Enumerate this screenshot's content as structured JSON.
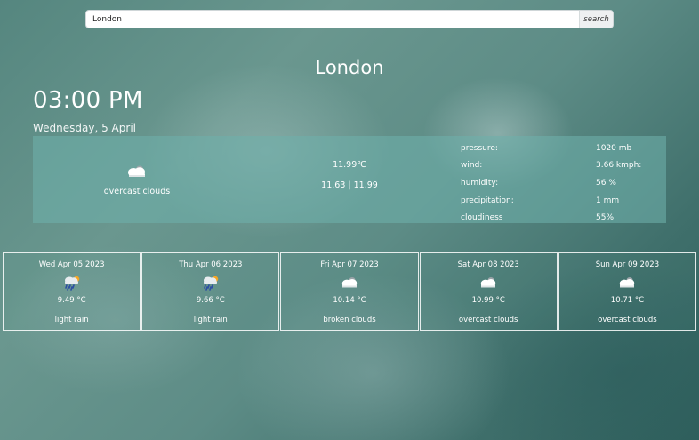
{
  "search": {
    "value": "London",
    "button_label": "search"
  },
  "city": "London",
  "time": "03:00 PM",
  "date": "Wednesday, 5 April",
  "current": {
    "icon": "cloud-icon",
    "description": "overcast clouds",
    "temperature": "11.99℃",
    "min_max": "11.63 | 11.99",
    "details": [
      {
        "label": "pressure:",
        "value": "1020 mb"
      },
      {
        "label": "wind:",
        "value": "3.66 kmph:"
      },
      {
        "label": "humidity:",
        "value": "56 %"
      },
      {
        "label": "precipitation:",
        "value": "1 mm"
      },
      {
        "label": "cloudiness",
        "value": "55%"
      }
    ]
  },
  "forecast": [
    {
      "date": "Wed Apr 05 2023",
      "icon": "rain-cloud-icon",
      "temp": "9.49 °C",
      "description": "light rain"
    },
    {
      "date": "Thu Apr 06 2023",
      "icon": "rain-cloud-icon",
      "temp": "9.66 °C",
      "description": "light rain"
    },
    {
      "date": "Fri Apr 07 2023",
      "icon": "cloud-icon",
      "temp": "10.14 °C",
      "description": "broken clouds"
    },
    {
      "date": "Sat Apr 08 2023",
      "icon": "cloud-icon",
      "temp": "10.99 °C",
      "description": "overcast clouds"
    },
    {
      "date": "Sun Apr 09 2023",
      "icon": "cloud-icon",
      "temp": "10.71 °C",
      "description": "overcast clouds"
    }
  ]
}
